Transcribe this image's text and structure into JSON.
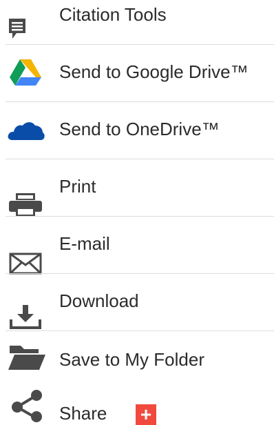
{
  "menu": {
    "items": [
      {
        "label": "Citation Tools",
        "icon": "citation-comment-icon"
      },
      {
        "label": "Send to Google Drive™",
        "icon": "google-drive-icon"
      },
      {
        "label": "Send to OneDrive™",
        "icon": "onedrive-cloud-icon"
      },
      {
        "label": "Print",
        "icon": "printer-icon"
      },
      {
        "label": "E-mail",
        "icon": "envelope-icon"
      },
      {
        "label": "Download",
        "icon": "download-icon"
      },
      {
        "label": "Save to My Folder",
        "icon": "folder-open-icon"
      },
      {
        "label": "Share",
        "icon": "share-icon"
      }
    ],
    "share_badge": "+"
  },
  "colors": {
    "text": "#2b2b2b",
    "icon_gray": "#4a4a4a",
    "divider": "#dcdcdc",
    "drive_green": "#0f9d58",
    "drive_yellow": "#f4b400",
    "drive_blue": "#4285f4",
    "onedrive_blue": "#0a4da8",
    "share_badge": "#f04a3e"
  }
}
